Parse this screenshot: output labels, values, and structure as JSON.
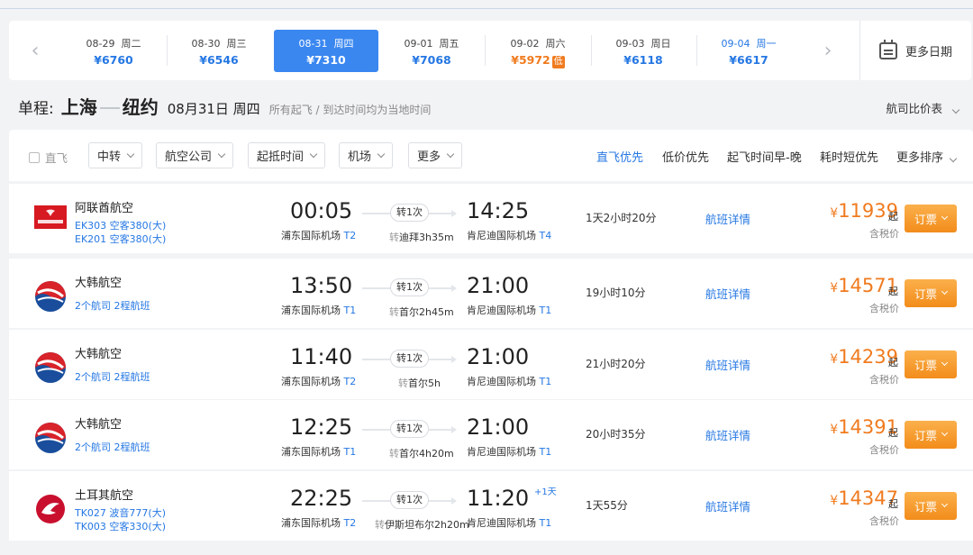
{
  "date_bar": {
    "dates": [
      {
        "date": "08-29",
        "weekday": "周二",
        "price": "¥6760",
        "low_tag": "",
        "state": ""
      },
      {
        "date": "08-30",
        "weekday": "周三",
        "price": "¥6546",
        "low_tag": "",
        "state": ""
      },
      {
        "date": "08-31",
        "weekday": "周四",
        "price": "¥7310",
        "low_tag": "",
        "state": "active"
      },
      {
        "date": "09-01",
        "weekday": "周五",
        "price": "¥7068",
        "low_tag": "",
        "state": ""
      },
      {
        "date": "09-02",
        "weekday": "周六",
        "price": "¥5972",
        "low_tag": "低",
        "state": "low"
      },
      {
        "date": "09-03",
        "weekday": "周日",
        "price": "¥6118",
        "low_tag": "",
        "state": ""
      },
      {
        "date": "09-04",
        "weekday": "周一",
        "price": "¥6617",
        "low_tag": "",
        "state": "blue"
      }
    ],
    "more_dates_label": "更多日期",
    "prev_icon": "chevron-left-icon",
    "next_icon": "chevron-right-icon"
  },
  "route": {
    "trip_label": "单程:",
    "origin": "上海",
    "destination": "纽约",
    "date": "08月31日 周四",
    "note": "所有起飞 / 到达时间均为当地时间",
    "price_chart_label": "航司比价表"
  },
  "filters": {
    "direct_label": "直飞",
    "dropdowns": [
      "中转",
      "航空公司",
      "起抵时间",
      "机场",
      "更多"
    ],
    "sorts": [
      "直飞优先",
      "低价优先",
      "起飞时间早-晚",
      "耗时短优先",
      "更多排序"
    ]
  },
  "flights": [
    {
      "airline": "阿联酋航空",
      "logo": "emirates",
      "sub1": "EK303 空客380(大)",
      "sub2": "EK201 空客380(大)",
      "dep_time": "00:05",
      "dep_airport": "浦东国际机场",
      "dep_terminal": "T2",
      "stops": "转1次",
      "via_prefix": "转",
      "via": "迪拜3h35m",
      "arr_time": "14:25",
      "arr_airport": "肯尼迪国际机场",
      "arr_terminal": "T4",
      "plus_day": "",
      "duration": "1天2小时20分",
      "details_label": "航班详情",
      "price_currency": "¥",
      "price": "11939",
      "price_suffix": "起",
      "tax_note": "含税价",
      "book_label": "订票"
    },
    {
      "airline": "大韩航空",
      "logo": "korean-air",
      "sub1": "2个航司  2程航班",
      "sub2": "",
      "dep_time": "13:50",
      "dep_airport": "浦东国际机场",
      "dep_terminal": "T1",
      "stops": "转1次",
      "via_prefix": "转",
      "via": "首尔2h45m",
      "arr_time": "21:00",
      "arr_airport": "肯尼迪国际机场",
      "arr_terminal": "T1",
      "plus_day": "",
      "duration": "19小时10分",
      "details_label": "航班详情",
      "price_currency": "¥",
      "price": "14571",
      "price_suffix": "起",
      "tax_note": "含税价",
      "book_label": "订票"
    },
    {
      "airline": "大韩航空",
      "logo": "korean-air",
      "sub1": "2个航司  2程航班",
      "sub2": "",
      "dep_time": "11:40",
      "dep_airport": "浦东国际机场",
      "dep_terminal": "T2",
      "stops": "转1次",
      "via_prefix": "转",
      "via": "首尔5h",
      "arr_time": "21:00",
      "arr_airport": "肯尼迪国际机场",
      "arr_terminal": "T1",
      "plus_day": "",
      "duration": "21小时20分",
      "details_label": "航班详情",
      "price_currency": "¥",
      "price": "14239",
      "price_suffix": "起",
      "tax_note": "含税价",
      "book_label": "订票"
    },
    {
      "airline": "大韩航空",
      "logo": "korean-air",
      "sub1": "2个航司  2程航班",
      "sub2": "",
      "dep_time": "12:25",
      "dep_airport": "浦东国际机场",
      "dep_terminal": "T1",
      "stops": "转1次",
      "via_prefix": "转",
      "via": "首尔4h20m",
      "arr_time": "21:00",
      "arr_airport": "肯尼迪国际机场",
      "arr_terminal": "T1",
      "plus_day": "",
      "duration": "20小时35分",
      "details_label": "航班详情",
      "price_currency": "¥",
      "price": "14391",
      "price_suffix": "起",
      "tax_note": "含税价",
      "book_label": "订票"
    },
    {
      "airline": "土耳其航空",
      "logo": "turkish-airlines",
      "sub1": "TK027 波音777(大)",
      "sub2": "TK003 空客330(大)",
      "dep_time": "22:25",
      "dep_airport": "浦东国际机场",
      "dep_terminal": "T2",
      "stops": "转1次",
      "via_prefix": "转",
      "via": "伊斯坦布尔2h20m",
      "arr_time": "11:20",
      "arr_airport": "肯尼迪国际机场",
      "arr_terminal": "T1",
      "plus_day": "+1天",
      "duration": "1天55分",
      "details_label": "航班详情",
      "price_currency": "¥",
      "price": "14347",
      "price_suffix": "起",
      "tax_note": "含税价",
      "book_label": "订票"
    }
  ],
  "colors": {
    "accent_blue": "#2577e3",
    "active_date_bg": "#3a87f0",
    "price_orange": "#f07b1f",
    "emirates_red": "#d71921",
    "korean_blue": "#1a4e9c",
    "korean_red": "#d8232a",
    "turkish_red": "#c8102e"
  }
}
